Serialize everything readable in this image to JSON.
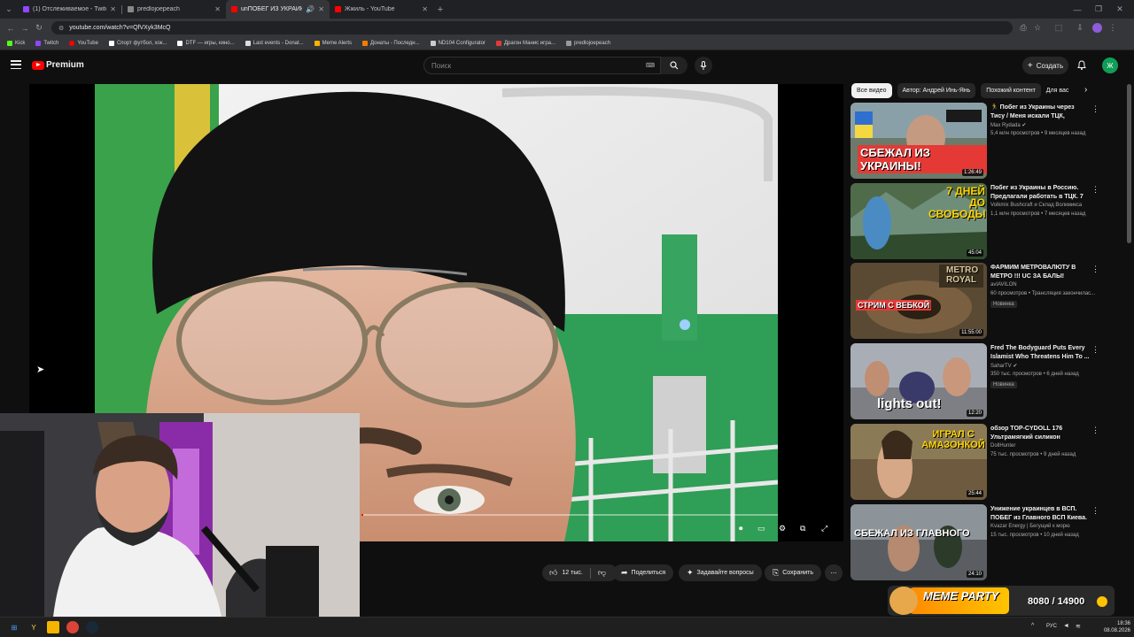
{
  "browser": {
    "tabs": [
      {
        "title": "(1) Отслеживаемое - Twitch",
        "color": "#9146ff",
        "active": false
      },
      {
        "title": "predlojoepeach",
        "color": "#888888",
        "active": false
      },
      {
        "title": "unПОБЕГ ИЗ УКРАИНЫ | П...",
        "color": "#ff0000",
        "active": true
      },
      {
        "title": "Жжиль - YouTube",
        "color": "#ff0000",
        "active": false
      }
    ],
    "url": "youtube.com/watch?v=QfVXyk3McQ",
    "bookmarks": [
      "Kick",
      "Twitch",
      "YouTube",
      "Спорт футбол, хок...",
      "DTF — игры, кино...",
      "Last events - Donat...",
      "Meme Alerts",
      "Донаты - Последн...",
      "ND104 Configurator",
      "Драгон Манис игра...",
      "predlojoepeach"
    ]
  },
  "header": {
    "logo_text": "Premium",
    "search_placeholder": "Поиск",
    "create_label": "Создать",
    "avatar_letter": "Ж"
  },
  "actions": {
    "likes": "12 тыс.",
    "share": "Поделиться",
    "ask": "Задавайте вопросы",
    "save": "Сохранить"
  },
  "sidebar": {
    "chips": [
      "Все видео",
      "Автор: Андрей Инь-Янь",
      "Похожий контент",
      "Для вас"
    ],
    "videos": [
      {
        "title": "🏃 Побег из Украины через Тису / Меня искали ТЦК, Радикалы -...",
        "channel": "Max Rydada ✔",
        "meta": "5,4 млн просмотров • 9 месяцев назад",
        "duration": "1:26:49",
        "badge": "",
        "thumb_text": "СБЕЖАЛ ИЗ УКРАИНЫ!",
        "bg": "#6b7a6a"
      },
      {
        "title": "Побег из Украины в Россию. Предлагали работать в ТЦК. 7 ...",
        "channel": "Volkmix Bushcraft и Склад Волкмикса",
        "meta": "1,1 млн просмотров • 7 месяцев назад",
        "duration": "45:04",
        "badge": "",
        "thumb_text": "7 ДНЕЙ ДО СВОБОДЫ",
        "bg": "#4f6b4a"
      },
      {
        "title": "ФАРМИМ МЕТРОВАЛЮТУ В МЕТРО !!! UC ЗА БАЛЫ!команд...",
        "channel": "avIAVILON",
        "meta": "60 просмотров • Трансляция закончилас...",
        "duration": "11:55:00",
        "badge": "Новинка",
        "thumb_text": "СТРИМ С ВЕБКОЙ",
        "bg": "#5a4a34"
      },
      {
        "title": "Fred The Bodyguard Puts Every Islamist Who Threatens Him To ...",
        "channel": "SaharTV ✔",
        "meta": "350 тыс. просмотров • 6 дней назад",
        "duration": "12:20",
        "badge": "Новинка",
        "thumb_text": "lights out!",
        "bg": "#7d7f84"
      },
      {
        "title": "обзор TOP-CYDOLL 176 Ультрамягкий силикон",
        "channel": "DollHunter",
        "meta": "75 тыс. просмотров • 9 дней назад",
        "duration": "25:44",
        "badge": "",
        "thumb_text": "ИГРАЛ С АМАЗОНКОЙ",
        "bg": "#6e5a3e"
      },
      {
        "title": "Унижение украинцев в ВСП. ПОБЕГ из Главного ВСП Киева. ...",
        "channel": "Kvazar Energy | Бегущий к морю",
        "meta": "15 тыс. просмотров • 10 дней назад",
        "duration": "24:10",
        "badge": "",
        "thumb_text": "СБЕЖАЛ ИЗ ГЛАВНОГО ВСП КИЕВА",
        "bg": "#5a5e63"
      }
    ]
  },
  "overlay": {
    "meme_text": "MEME PARTY",
    "meme_progress": "8080 / 14900",
    "meme_progress_fraction": 0.54
  },
  "taskbar": {
    "lang": "РУС",
    "time": "18:36",
    "date": "08.08.2026"
  }
}
